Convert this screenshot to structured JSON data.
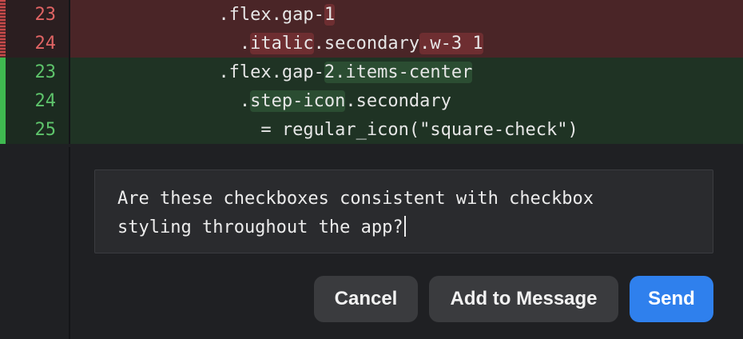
{
  "diff": {
    "lines": [
      {
        "type": "removed",
        "number": "23",
        "indent": "              ",
        "segments": [
          {
            "text": ".flex.gap-",
            "hl": false
          },
          {
            "text": "1",
            "hl": true
          }
        ]
      },
      {
        "type": "removed",
        "number": "24",
        "indent": "                ",
        "segments": [
          {
            "text": ".",
            "hl": false
          },
          {
            "text": "italic",
            "hl": true
          },
          {
            "text": ".secondary",
            "hl": false
          },
          {
            "text": ".w-3 1",
            "hl": true
          }
        ]
      },
      {
        "type": "added",
        "number": "23",
        "indent": "              ",
        "segments": [
          {
            "text": ".flex.gap-",
            "hl": false
          },
          {
            "text": "2.items-center",
            "hl": true
          }
        ]
      },
      {
        "type": "added",
        "number": "24",
        "indent": "                ",
        "segments": [
          {
            "text": ".",
            "hl": false
          },
          {
            "text": "step-icon",
            "hl": true
          },
          {
            "text": ".secondary",
            "hl": false
          }
        ]
      },
      {
        "type": "added",
        "number": "25",
        "indent": "                  ",
        "segments": [
          {
            "text": "= regular_icon(\"square-check\")",
            "hl": false
          }
        ]
      }
    ]
  },
  "comment": {
    "text": "Are these checkboxes consistent with checkbox\nstyling throughout the app?"
  },
  "actions": {
    "cancel_label": "Cancel",
    "add_label": "Add to Message",
    "send_label": "Send"
  },
  "colors": {
    "removed_bg": "#4a2527",
    "added_bg": "#1f3324",
    "removed_number": "#e06464",
    "added_number": "#5ec46b",
    "primary": "#2f80ed"
  }
}
